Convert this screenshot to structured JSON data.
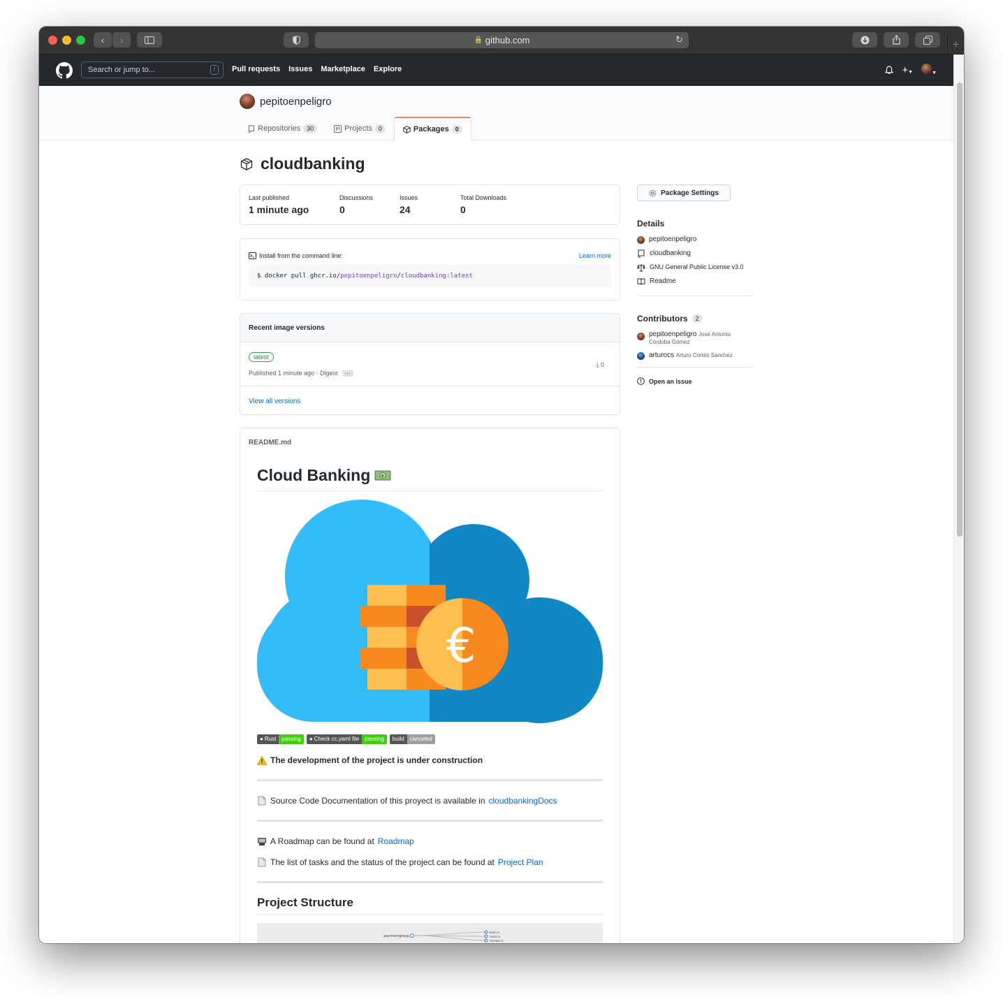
{
  "browser": {
    "url": "github.com"
  },
  "header": {
    "search_placeholder": "Search or jump to...",
    "search_shortcut": "/",
    "nav": [
      "Pull requests",
      "Issues",
      "Marketplace",
      "Explore"
    ],
    "plus": "+"
  },
  "profile": {
    "owner": "pepitoenpeligro",
    "tabs": [
      {
        "label": "Repositories",
        "count": "30"
      },
      {
        "label": "Projects",
        "count": "0"
      },
      {
        "label": "Packages",
        "count": "0"
      }
    ]
  },
  "package": {
    "name": "cloudbanking",
    "stats": [
      {
        "label": "Last published",
        "value": "1 minute ago"
      },
      {
        "label": "Discussions",
        "value": "0"
      },
      {
        "label": "Issues",
        "value": "24"
      },
      {
        "label": "Total Downloads",
        "value": "0"
      }
    ],
    "install": {
      "heading": "Install from the command line:",
      "learn_more": "Learn more",
      "cmd_prefix": "$ docker pull ghcr.io/",
      "cmd_owner": "pepitoenpeligro",
      "cmd_sep": "/",
      "cmd_image": "cloudbanking:latest"
    },
    "versions": {
      "heading": "Recent image versions",
      "tag": "latest",
      "published": "Published 1 minute ago · Digest",
      "digest_dots": "···",
      "downloads": "0",
      "view_all": "View all versions"
    }
  },
  "readme": {
    "filename": "README.md",
    "title": "Cloud Banking",
    "badges": [
      {
        "left": "Rust",
        "right": "passing",
        "status": "pass"
      },
      {
        "left": "Check cc.yaml file",
        "right": "passing",
        "status": "pass"
      },
      {
        "left": "build",
        "right": "canceled",
        "status": "cancel"
      }
    ],
    "warning": "The development of the project is under construction",
    "doc_text": "Source Code Documentation of this proyect is available in",
    "doc_link": "cloudbankingDocs",
    "roadmap_text": "A Roadmap can be found at",
    "roadmap_link": "Roadmap",
    "plan_text": "The list of tasks and the status of the project can be found at",
    "plan_link": "Project Plan",
    "structure_heading": "Project Structure",
    "structure_node": "paymentgroup",
    "structure_files": [
      "test.rs",
      "mod.rs",
      "model.rs"
    ]
  },
  "sidebar": {
    "settings": "Package Settings",
    "details_heading": "Details",
    "details": [
      "pepitoenpeligro",
      "cloudbanking",
      "GNU General Public License v3.0",
      "Readme"
    ],
    "contributors_heading": "Contributors",
    "contributors_count": "2",
    "contributors": [
      {
        "login": "pepitoenpeligro",
        "name": "José Antonio Córdoba Gómez"
      },
      {
        "login": "arturocs",
        "name": "Arturo Cortés Sánchez"
      }
    ],
    "open_issue": "Open an issue"
  },
  "colors": {
    "header_bg": "#24292e",
    "link": "#0366d6",
    "active_tab_border": "#f9826c",
    "badge_pass": "#44cc11",
    "badge_cancel": "#9f9f9f"
  }
}
